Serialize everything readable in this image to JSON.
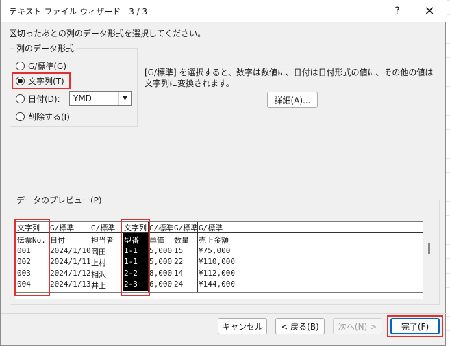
{
  "dialog": {
    "title": "テキスト ファイル ウィザード - 3 / 3",
    "help_label": "?",
    "close_label": "✕"
  },
  "instruction": "区切ったあとの列のデータ形式を選択してください。",
  "format_group": {
    "legend": "列のデータ形式",
    "options": [
      {
        "label": "G/標準(G)",
        "checked": false
      },
      {
        "label": "文字列(T)",
        "checked": true
      },
      {
        "label": "日付(D):",
        "checked": false
      },
      {
        "label": "削除する(I)",
        "checked": false
      }
    ],
    "date_format": "YMD"
  },
  "description": "[G/標準] を選択すると、数字は数値に、日付は日付形式の値に、その他の値は文字列に変換されます。",
  "advanced_button": "詳細(A)...",
  "preview": {
    "label": "データのプレビュー(P)",
    "header": [
      "文字列",
      "G/標準",
      "G/標準",
      "文字列",
      "G/標準",
      "G/標準",
      "G/標準"
    ],
    "rows": [
      [
        "伝票No.",
        "日付",
        "担当者",
        "型番",
        "単価",
        "数量",
        "売上金額"
      ],
      [
        "001",
        "2024/1/10",
        "岡田",
        "1-1",
        "5,000",
        "15",
        "¥75,000"
      ],
      [
        "002",
        "2024/1/11",
        "上村",
        "1-1",
        "5,000",
        "22",
        "¥110,000"
      ],
      [
        "003",
        "2024/1/12",
        "相沢",
        "2-2",
        "8,000",
        "14",
        "¥112,000"
      ],
      [
        "004",
        "2024/1/13",
        "井上",
        "2-3",
        "6,000",
        "24",
        "¥144,000"
      ]
    ],
    "selected_column": 3
  },
  "footer": {
    "cancel": "キャンセル",
    "back": "< 戻る(B)",
    "next": "次へ(N) >",
    "finish": "完了(F)"
  },
  "colors": {
    "highlight": "#e03030",
    "primary_border": "#0067c0",
    "dialog_bg": "#f0f0f0"
  }
}
